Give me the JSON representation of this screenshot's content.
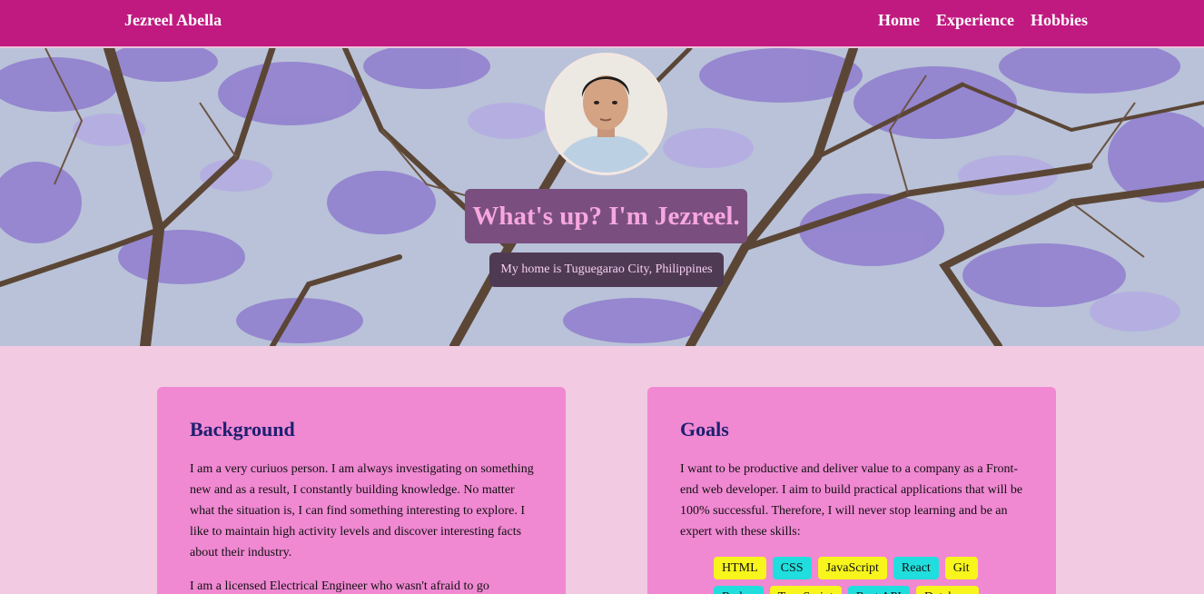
{
  "nav": {
    "brand": "Jezreel Abella",
    "links": [
      "Home",
      "Experience",
      "Hobbies"
    ]
  },
  "hero": {
    "title": "What's up? I'm Jezreel.",
    "subtitle": "My home is Tuguegarao City, Philippines"
  },
  "background": {
    "heading": "Background",
    "paragraph1": "I am a very curiuos person. I am always investigating on something new and as a result, I constantly building knowledge. No matter what the situation is, I can find something interesting to explore. I like to maintain high activity levels and discover interesting facts about their industry.",
    "paragraph2": "I am a licensed Electrical Engineer who wasn't afraid to go"
  },
  "goals": {
    "heading": "Goals",
    "paragraph": "I want to be productive and deliver value to a company as a Front-end web developer. I aim to build practical applications that will be 100% successful. Therefore, I will never stop learning and be an expert with these skills:",
    "skills": [
      "HTML",
      "CSS",
      "JavaScript",
      "React",
      "Git",
      "Redux",
      "TypeScript",
      "Rest API",
      "Database"
    ]
  },
  "colors": {
    "navbar": "#c01a80",
    "page": "#f2cae2",
    "card": "#f088d2",
    "heading": "#1e2070",
    "skill_yellow": "#f8f51c",
    "skill_cyan": "#20dede"
  }
}
